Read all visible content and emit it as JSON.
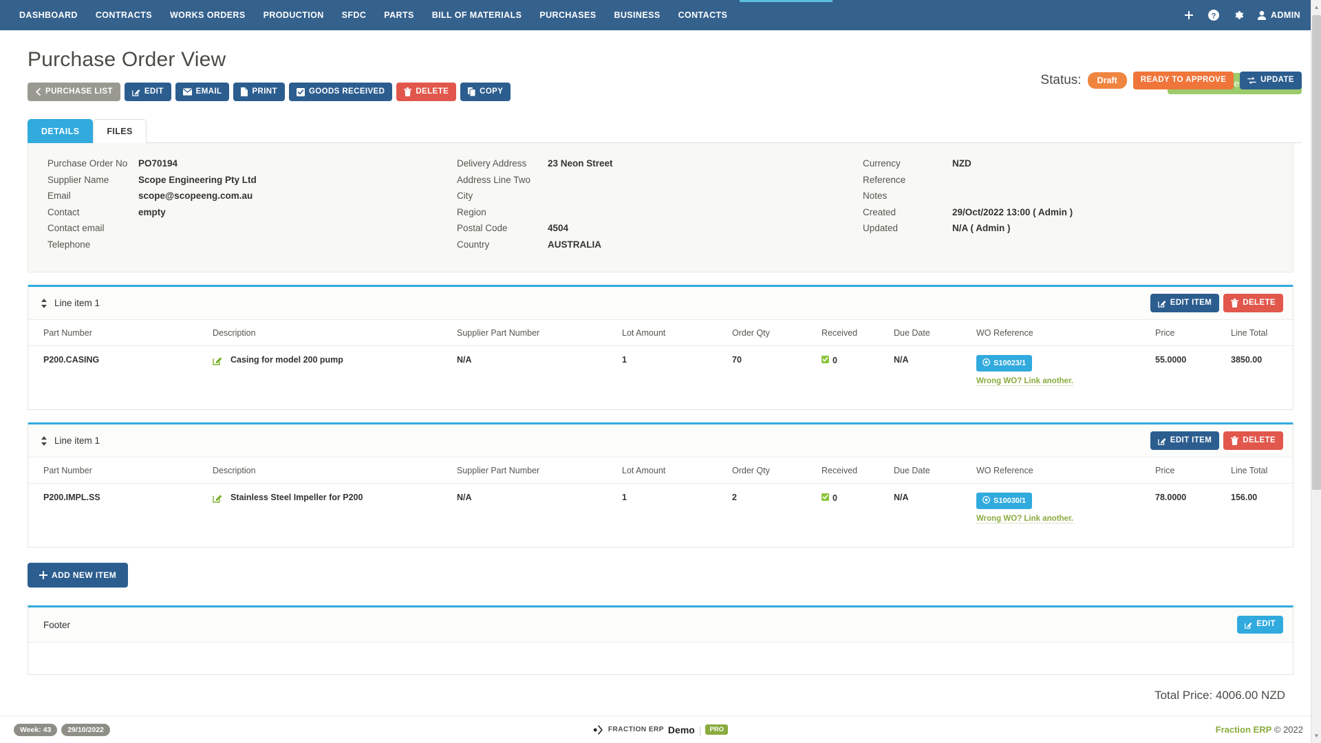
{
  "nav": {
    "links": [
      {
        "label": "DASHBOARD"
      },
      {
        "label": "CONTRACTS"
      },
      {
        "label": "WORKS ORDERS"
      },
      {
        "label": "PRODUCTION"
      },
      {
        "label": "SFDC"
      },
      {
        "label": "PARTS"
      },
      {
        "label": "BILL OF MATERIALS"
      },
      {
        "label": "PURCHASES"
      },
      {
        "label": "BUSINESS"
      },
      {
        "label": "CONTACTS"
      }
    ],
    "icons": [
      "plus-icon",
      "help-circle-icon",
      "gear-icon"
    ],
    "user": "ADMIN"
  },
  "header": {
    "title": "Purchase Order View",
    "toolbar": [
      {
        "label": "PURCHASE LIST",
        "icon": "chevron-left-icon",
        "style": "grey"
      },
      {
        "label": "EDIT",
        "icon": "pencil-square-icon",
        "style": "navy"
      },
      {
        "label": "EMAIL",
        "icon": "envelope-icon",
        "style": "navy"
      },
      {
        "label": "PRINT",
        "icon": "file-icon",
        "style": "navy"
      },
      {
        "label": "GOODS RECEIVED",
        "icon": "check-square-icon",
        "style": "navy"
      },
      {
        "label": "DELETE",
        "icon": "trash-icon",
        "style": "red"
      },
      {
        "label": "COPY",
        "icon": "copy-icon",
        "style": "navy"
      }
    ]
  },
  "alert": {
    "message": "Purchase order created.",
    "close": "×",
    "color": "#9ccb6a"
  },
  "status": {
    "label": "Status:",
    "value": "Draft",
    "approve_label": "READY TO APPROVE",
    "update_label": "UPDATE",
    "draft_color": "#f0853f",
    "approve_color": "#f0753a"
  },
  "tabs": [
    {
      "label": "DETAILS",
      "active": true
    },
    {
      "label": "FILES",
      "active": false
    }
  ],
  "details": {
    "column1": [
      {
        "label": "Purchase Order No",
        "value": "PO70194"
      },
      {
        "label": "Supplier Name",
        "value": "Scope Engineering Pty Ltd"
      },
      {
        "label": "Email",
        "value": "scope@scopeeng.com.au"
      },
      {
        "label": "Contact",
        "value": "empty"
      },
      {
        "label": "Contact email",
        "value": ""
      },
      {
        "label": "Telephone",
        "value": ""
      }
    ],
    "column2": [
      {
        "label": "Delivery Address",
        "value": "23 Neon Street"
      },
      {
        "label": "Address Line Two",
        "value": ""
      },
      {
        "label": "City",
        "value": ""
      },
      {
        "label": "Region",
        "value": ""
      },
      {
        "label": "Postal Code",
        "value": "4504"
      },
      {
        "label": "Country",
        "value": "AUSTRALIA"
      }
    ],
    "column3": [
      {
        "label": "Currency",
        "value": "NZD"
      },
      {
        "label": "Reference",
        "value": ""
      },
      {
        "label": "Notes",
        "value": ""
      },
      {
        "label": "Created",
        "value": "29/Oct/2022 13:00 ( Admin )"
      },
      {
        "label": "Updated",
        "value": "N/A ( Admin )"
      }
    ]
  },
  "line_item_columns": [
    "Part Number",
    "Description",
    "Supplier Part Number",
    "Lot Amount",
    "Order Qty",
    "Received",
    "Due Date",
    "WO Reference",
    "Price",
    "Line Total"
  ],
  "line_items": [
    {
      "title": "Line item 1",
      "edit_label": "EDIT ITEM",
      "delete_label": "DELETE",
      "part_number": "P200.CASING",
      "description": "Casing for model 200 pump",
      "supplier_part_number": "N/A",
      "lot_amount": "1",
      "order_qty": "70",
      "received": "0",
      "due_date": "N/A",
      "wo_reference": "S10023/1",
      "wo_link": "Wrong WO? Link another.",
      "price": "55.0000",
      "line_total": "3850.00"
    },
    {
      "title": "Line item 1",
      "edit_label": "EDIT ITEM",
      "delete_label": "DELETE",
      "part_number": "P200.IMPL.SS",
      "description": "Stainless Steel Impeller for P200",
      "supplier_part_number": "N/A",
      "lot_amount": "1",
      "order_qty": "2",
      "received": "0",
      "due_date": "N/A",
      "wo_reference": "S10030/1",
      "wo_link": "Wrong WO? Link another.",
      "price": "78.0000",
      "line_total": "156.00"
    }
  ],
  "add_new_item": "ADD NEW ITEM",
  "footer_panel": {
    "title": "Footer",
    "edit_label": "EDIT"
  },
  "total_price": "Total Price: 4006.00 NZD",
  "bottombar": {
    "week": "Week: 43",
    "date": "29/10/2022",
    "brand_name": "FRACTION ERP",
    "brand_demo": "Demo",
    "brand_sep": "|",
    "brand_pro": "PRO",
    "copyright_brand": "Fraction ERP",
    "copyright_rest": "© 2022"
  }
}
